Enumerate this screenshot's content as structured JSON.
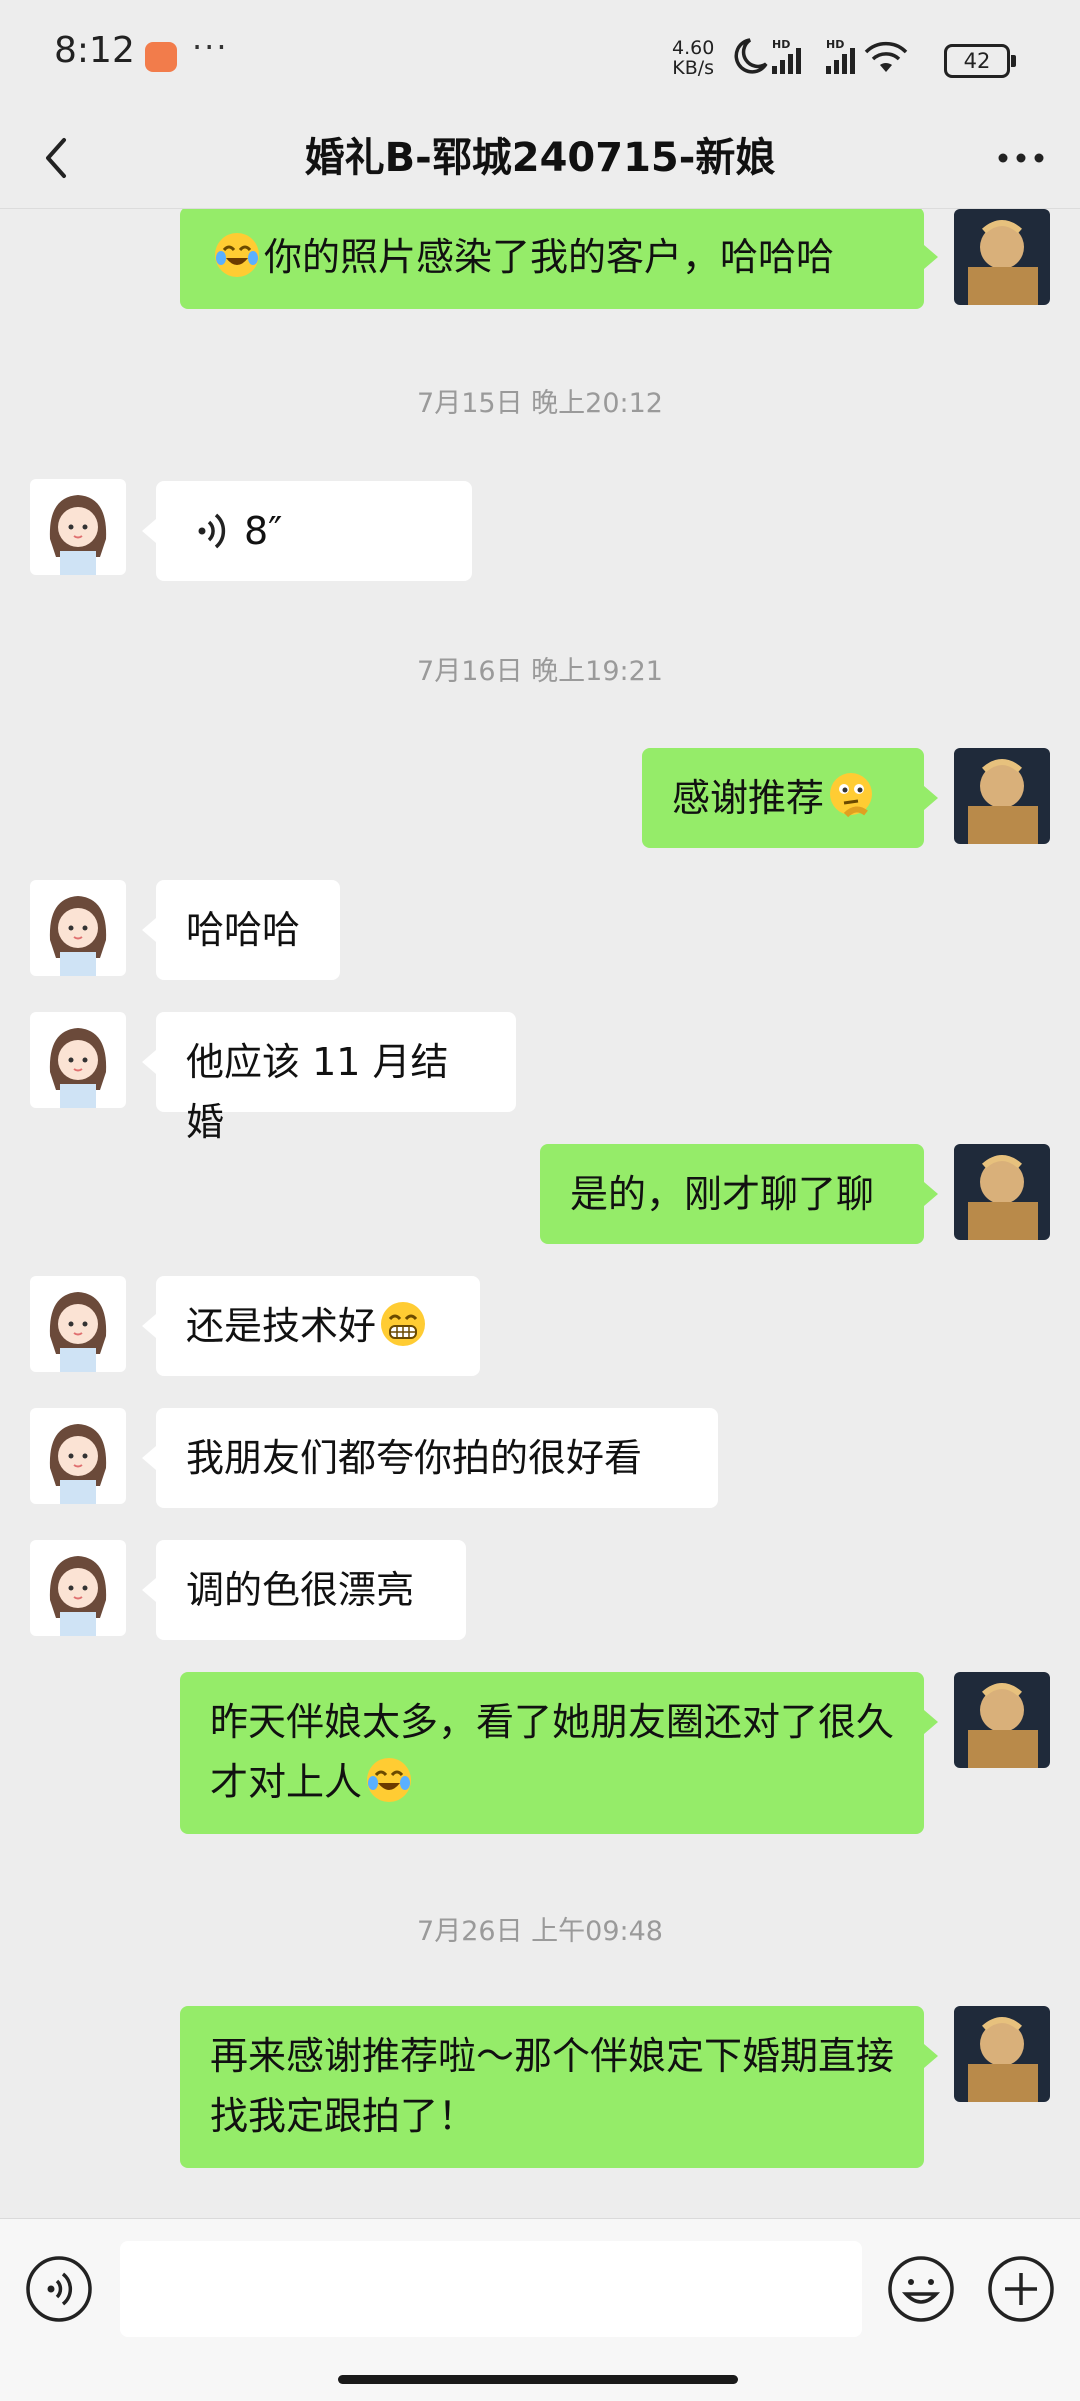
{
  "status_bar": {
    "time": "8:12",
    "network_speed_value": "4.60",
    "network_speed_unit": "KB/s",
    "battery": "42",
    "icons": [
      "notification-app-icon",
      "more-dots-icon",
      "moon-icon",
      "hd-signal-icon",
      "hd-signal-icon",
      "wifi-icon",
      "battery-icon"
    ]
  },
  "header": {
    "title": "婚礼B-郓城240715-新娘"
  },
  "timestamps": [
    "7月15日 晚上20:12",
    "7月16日 晚上19:21",
    "7月26日 上午09:48"
  ],
  "messages": [
    {
      "side": "out",
      "text": "你的照片感染了我的客户，哈哈哈",
      "emoji_before": "laugh-cry-emoji"
    },
    {
      "side": "in",
      "type": "voice",
      "duration": "8″"
    },
    {
      "side": "out",
      "text": "感谢推荐",
      "emoji_after": "thinking-emoji"
    },
    {
      "side": "in",
      "text": "哈哈哈"
    },
    {
      "side": "in",
      "text": "他应该 11 月结婚"
    },
    {
      "side": "out",
      "text": "是的，刚才聊了聊"
    },
    {
      "side": "in",
      "text": "还是技术好",
      "emoji_after": "grin-emoji"
    },
    {
      "side": "in",
      "text": "我朋友们都夸你拍的很好看"
    },
    {
      "side": "in",
      "text": "调的色很漂亮"
    },
    {
      "side": "out",
      "text": "昨天伴娘太多，看了她朋友圈还对了很久才对上人",
      "emoji_after": "laugh-cry-emoji"
    },
    {
      "side": "out",
      "text": "再来感谢推荐啦～那个伴娘定下婚期直接找我定跟拍了！"
    }
  ],
  "input_bar": {
    "placeholder": ""
  },
  "colors": {
    "background": "#ededed",
    "bubble_out": "#95ec69",
    "bubble_in": "#ffffff",
    "timestamp": "#9a9a9a"
  }
}
